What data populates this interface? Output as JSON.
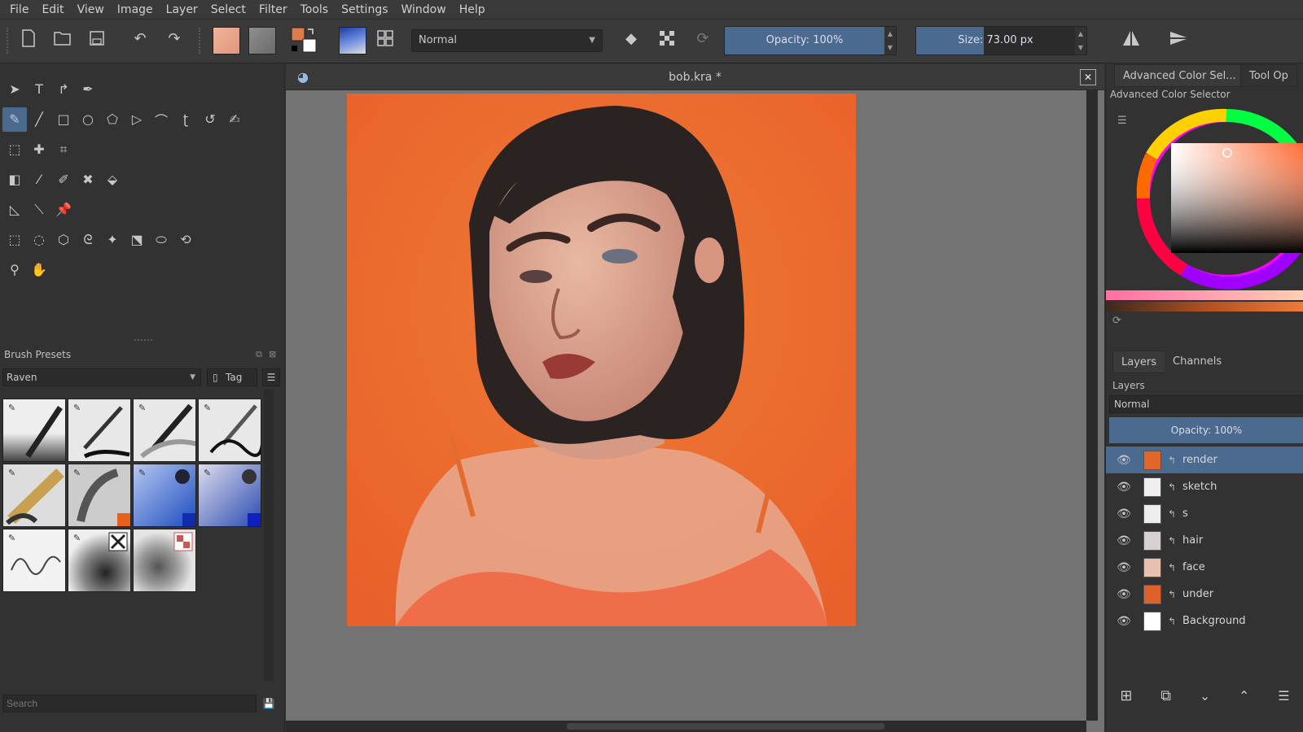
{
  "menu": [
    "File",
    "Edit",
    "View",
    "Image",
    "Layer",
    "Select",
    "Filter",
    "Tools",
    "Settings",
    "Window",
    "Help"
  ],
  "toolbar": {
    "blend_mode": "Normal",
    "opacity_label": "Opacity:  100%",
    "opacity_value": 100,
    "size_label": "Size:  73.00 px",
    "size_value": 73.0,
    "fg_color": "#e07b4e",
    "bg_color": "#ffffff"
  },
  "document": {
    "title": "bob.kra *",
    "close": "✕"
  },
  "brush_presets": {
    "title": "Brush Presets",
    "tag_filter": "Raven",
    "tag_label": "Tag",
    "search_placeholder": "Search"
  },
  "right_dock": {
    "tabs": [
      "Advanced Color Sel...",
      "Tool Op"
    ],
    "color_selector_title": "Advanced Color Selector",
    "layer_tabs": [
      "Layers",
      "Channels"
    ],
    "layers_title": "Layers",
    "layer_blend_mode": "Normal",
    "layer_opacity_label": "Opacity:  100%",
    "layers": [
      {
        "name": "render",
        "selected": true
      },
      {
        "name": "sketch",
        "selected": false
      },
      {
        "name": "s",
        "selected": false
      },
      {
        "name": "hair",
        "selected": false
      },
      {
        "name": "face",
        "selected": false
      },
      {
        "name": "under",
        "selected": false
      },
      {
        "name": "Background",
        "selected": false
      }
    ]
  },
  "colors": {
    "accent": "#4a6a8f",
    "canvas_bg": "#ef6a2c",
    "panel": "#323232"
  }
}
